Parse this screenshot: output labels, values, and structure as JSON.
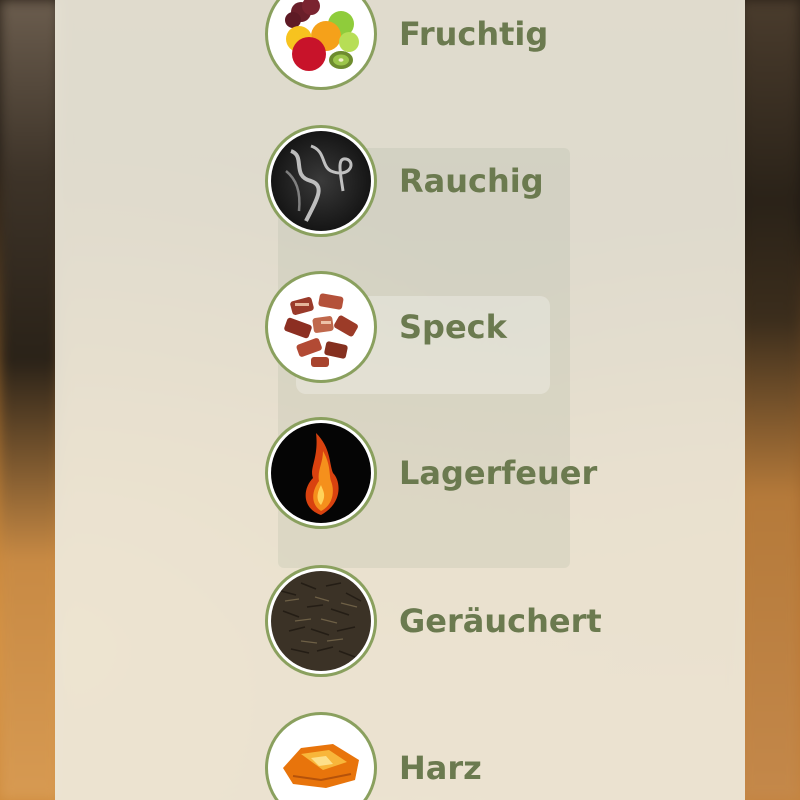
{
  "flavors": [
    {
      "label": "Fruchtig",
      "icon": "fruit-bowl-icon"
    },
    {
      "label": "Rauchig",
      "icon": "smoke-icon"
    },
    {
      "label": "Speck",
      "icon": "bacon-icon"
    },
    {
      "label": "Lagerfeuer",
      "icon": "fire-icon"
    },
    {
      "label": "Geräuchert",
      "icon": "smoked-tea-leaves-icon"
    },
    {
      "label": "Harz",
      "icon": "resin-icon"
    }
  ],
  "colors": {
    "accent_green": "#8aa05e",
    "label_text": "#6b7a4f",
    "panel_background": "#eee9dc"
  }
}
